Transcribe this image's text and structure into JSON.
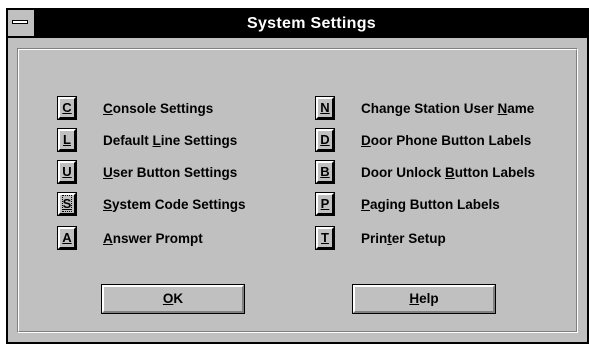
{
  "window": {
    "title": "System Settings"
  },
  "left_items": [
    {
      "key": "C",
      "pre": "",
      "ul": "C",
      "post": "onsole Settings"
    },
    {
      "key": "L",
      "pre": "Default ",
      "ul": "L",
      "post": "ine Settings"
    },
    {
      "key": "U",
      "pre": "",
      "ul": "U",
      "post": "ser Button Settings"
    },
    {
      "key": "S",
      "pre": "",
      "ul": "S",
      "post": "ystem Code Settings"
    },
    {
      "key": "A",
      "pre": "",
      "ul": "A",
      "post": "nswer Prompt"
    }
  ],
  "right_items": [
    {
      "key": "N",
      "pre": "Change Station User ",
      "ul": "N",
      "post": "ame"
    },
    {
      "key": "D",
      "pre": "",
      "ul": "D",
      "post": "oor Phone Button Labels"
    },
    {
      "key": "B",
      "pre": "Door Unlock ",
      "ul": "B",
      "post": "utton Labels"
    },
    {
      "key": "P",
      "pre": "",
      "ul": "P",
      "post": "aging Button Labels"
    },
    {
      "key": "T",
      "pre": "Prin",
      "ul": "t",
      "post": "er Setup"
    }
  ],
  "buttons": {
    "ok": {
      "ul": "O",
      "post": "K"
    },
    "help": {
      "ul": "H",
      "post": "elp"
    }
  }
}
